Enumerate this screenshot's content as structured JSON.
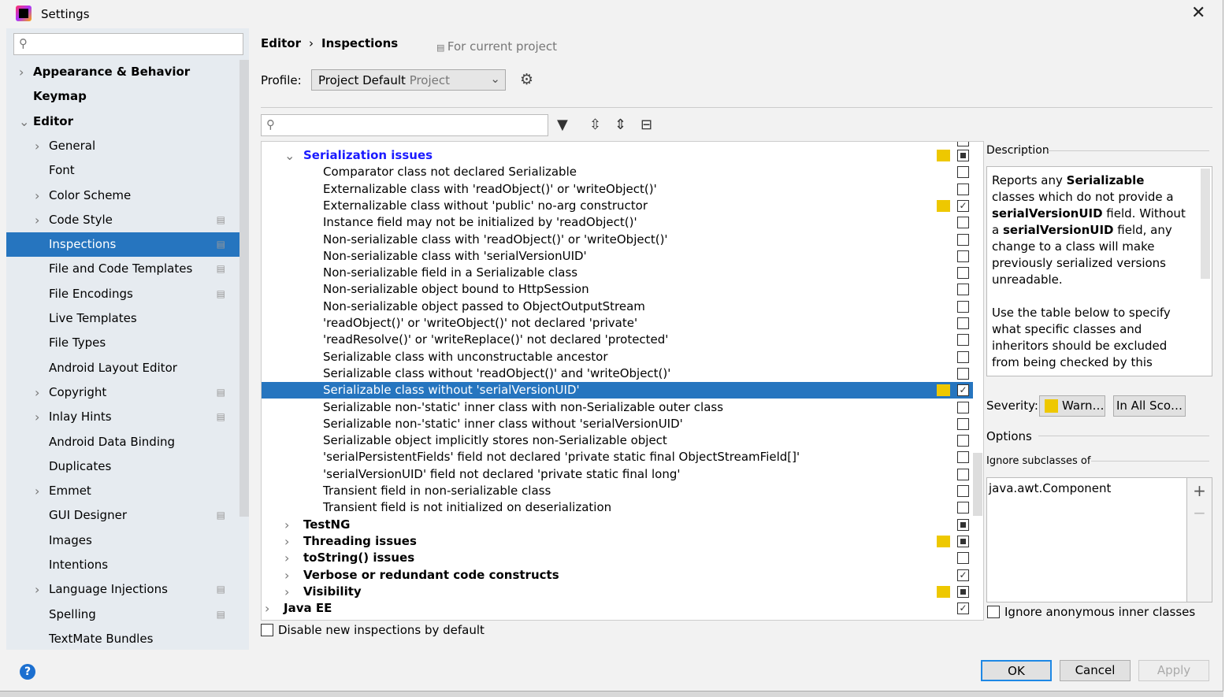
{
  "window": {
    "title": "Settings",
    "close": "✕"
  },
  "sidebar": {
    "items": [
      {
        "label": "Appearance & Behavior",
        "level": 0,
        "arrow": "›",
        "bold": true
      },
      {
        "label": "Keymap",
        "level": 0,
        "arrow": "",
        "bold": true
      },
      {
        "label": "Editor",
        "level": 0,
        "arrow": "⌄",
        "bold": true
      },
      {
        "label": "General",
        "level": 1,
        "arrow": "›"
      },
      {
        "label": "Font",
        "level": 1,
        "arrow": ""
      },
      {
        "label": "Color Scheme",
        "level": 1,
        "arrow": "›"
      },
      {
        "label": "Code Style",
        "level": 1,
        "arrow": "›",
        "proj": true
      },
      {
        "label": "Inspections",
        "level": 1,
        "arrow": "",
        "proj": true,
        "selected": true
      },
      {
        "label": "File and Code Templates",
        "level": 1,
        "arrow": "",
        "proj": true
      },
      {
        "label": "File Encodings",
        "level": 1,
        "arrow": "",
        "proj": true
      },
      {
        "label": "Live Templates",
        "level": 1,
        "arrow": ""
      },
      {
        "label": "File Types",
        "level": 1,
        "arrow": ""
      },
      {
        "label": "Android Layout Editor",
        "level": 1,
        "arrow": ""
      },
      {
        "label": "Copyright",
        "level": 1,
        "arrow": "›",
        "proj": true
      },
      {
        "label": "Inlay Hints",
        "level": 1,
        "arrow": "›",
        "proj": true
      },
      {
        "label": "Android Data Binding",
        "level": 1,
        "arrow": ""
      },
      {
        "label": "Duplicates",
        "level": 1,
        "arrow": ""
      },
      {
        "label": "Emmet",
        "level": 1,
        "arrow": "›"
      },
      {
        "label": "GUI Designer",
        "level": 1,
        "arrow": "",
        "proj": true
      },
      {
        "label": "Images",
        "level": 1,
        "arrow": ""
      },
      {
        "label": "Intentions",
        "level": 1,
        "arrow": ""
      },
      {
        "label": "Language Injections",
        "level": 1,
        "arrow": "›",
        "proj": true
      },
      {
        "label": "Spelling",
        "level": 1,
        "arrow": "",
        "proj": true
      },
      {
        "label": "TextMate Bundles",
        "level": 1,
        "arrow": ""
      }
    ]
  },
  "header": {
    "breadcrumb": [
      "Editor",
      "›",
      "Inspections"
    ],
    "for_project": "For current project",
    "profile_label": "Profile:",
    "profile_value": "Project Default",
    "profile_scope": "Project"
  },
  "tree": {
    "rows": [
      {
        "label": "Serialization issues",
        "level": 1,
        "arrow": "⌄",
        "group": true,
        "blue": true,
        "yellow": true,
        "state": "mixed"
      },
      {
        "label": "Comparator class not declared Serializable",
        "level": 2,
        "state": "off"
      },
      {
        "label": "Externalizable class with 'readObject()' or 'writeObject()'",
        "level": 2,
        "state": "off"
      },
      {
        "label": "Externalizable class without 'public' no-arg constructor",
        "level": 2,
        "yellow": true,
        "state": "on"
      },
      {
        "label": "Instance field may not be initialized by 'readObject()'",
        "level": 2,
        "state": "off"
      },
      {
        "label": "Non-serializable class with 'readObject()' or 'writeObject()'",
        "level": 2,
        "state": "off"
      },
      {
        "label": "Non-serializable class with 'serialVersionUID'",
        "level": 2,
        "state": "off"
      },
      {
        "label": "Non-serializable field in a Serializable class",
        "level": 2,
        "state": "off"
      },
      {
        "label": "Non-serializable object bound to HttpSession",
        "level": 2,
        "state": "off"
      },
      {
        "label": "Non-serializable object passed to ObjectOutputStream",
        "level": 2,
        "state": "off"
      },
      {
        "label": "'readObject()' or 'writeObject()' not declared 'private'",
        "level": 2,
        "state": "off"
      },
      {
        "label": "'readResolve()' or 'writeReplace()' not declared 'protected'",
        "level": 2,
        "state": "off"
      },
      {
        "label": "Serializable class with unconstructable ancestor",
        "level": 2,
        "state": "off"
      },
      {
        "label": "Serializable class without 'readObject()' and 'writeObject()'",
        "level": 2,
        "state": "off"
      },
      {
        "label": "Serializable class without 'serialVersionUID'",
        "level": 2,
        "yellow": true,
        "state": "on",
        "selected": true
      },
      {
        "label": "Serializable non-'static' inner class with non-Serializable outer class",
        "level": 2,
        "state": "off"
      },
      {
        "label": "Serializable non-'static' inner class without 'serialVersionUID'",
        "level": 2,
        "state": "off"
      },
      {
        "label": "Serializable object implicitly stores non-Serializable object",
        "level": 2,
        "state": "off"
      },
      {
        "label": "'serialPersistentFields' field not declared 'private static final ObjectStreamField[]'",
        "level": 2,
        "state": "off"
      },
      {
        "label": "'serialVersionUID' field not declared 'private static final long'",
        "level": 2,
        "state": "off"
      },
      {
        "label": "Transient field in non-serializable class",
        "level": 2,
        "state": "off"
      },
      {
        "label": "Transient field is not initialized on deserialization",
        "level": 2,
        "state": "off"
      },
      {
        "label": "TestNG",
        "level": 1,
        "arrow": "›",
        "group": true,
        "state": "mixed"
      },
      {
        "label": "Threading issues",
        "level": 1,
        "arrow": "›",
        "group": true,
        "yellow": true,
        "state": "mixed"
      },
      {
        "label": "toString() issues",
        "level": 1,
        "arrow": "›",
        "group": true,
        "state": "off"
      },
      {
        "label": "Verbose or redundant code constructs",
        "level": 1,
        "arrow": "›",
        "group": true,
        "state": "on"
      },
      {
        "label": "Visibility",
        "level": 1,
        "arrow": "›",
        "group": true,
        "yellow": true,
        "state": "mixed"
      },
      {
        "label": "Java EE",
        "level": 0,
        "arrow": "›",
        "group": true,
        "state": "on"
      }
    ],
    "disable_new": "Disable new inspections by default"
  },
  "description": {
    "label": "Description",
    "p1": [
      "Reports any ",
      "Serializable",
      " classes which do not provide a ",
      "serialVersionUID",
      " field. Without a ",
      "serialVersionUID",
      " field, any change to a class will make previously serialized versions unreadable."
    ],
    "p2": "Use the table below to specify what specific classes and inheritors should be excluded from being checked by this"
  },
  "severity": {
    "label": "Severity:",
    "value": "Warn…",
    "scope": "In All Sco…"
  },
  "options": {
    "label": "Options",
    "ignore_label": "Ignore subclasses of",
    "list": [
      "java.awt.Component"
    ],
    "add": "+",
    "remove": "−",
    "anon": "Ignore anonymous inner classes"
  },
  "footer": {
    "ok": "OK",
    "cancel": "Cancel",
    "apply": "Apply",
    "help": "?"
  },
  "colors": {
    "accent": "#2675bf",
    "warning": "#eec800",
    "group_blue": "#1a1aff"
  }
}
